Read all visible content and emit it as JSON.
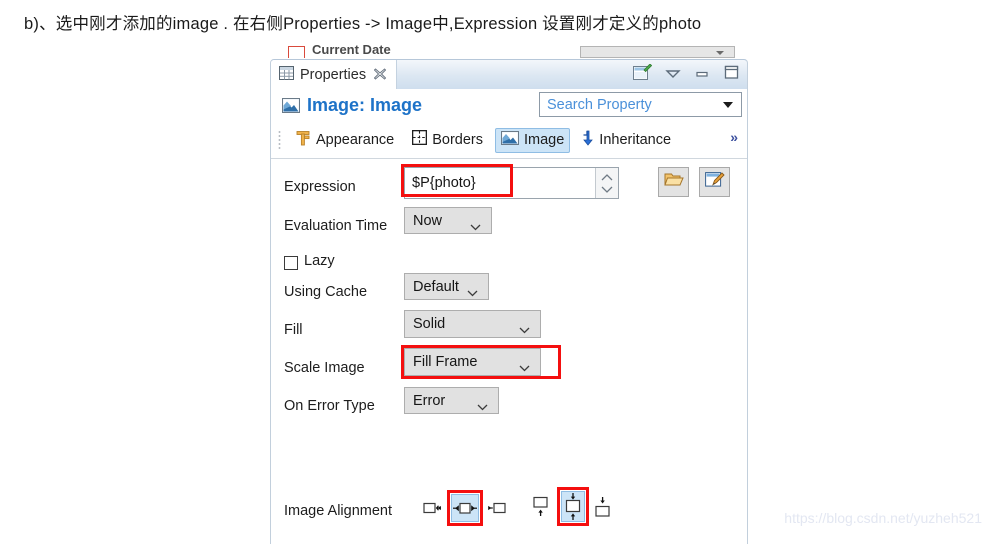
{
  "caption": "b)、选中刚才添加的image . 在右侧Properties -> Image中,Expression 设置刚才定义的photo",
  "cutoff_row": {
    "label": "Current Date"
  },
  "view": {
    "tab": {
      "title": "Properties",
      "close_glyph": "✄",
      "icon": "table-icon"
    },
    "toolbar": [
      {
        "name": "new-properties-view-icon",
        "label": ""
      },
      {
        "name": "view-menu-icon",
        "label": ""
      },
      {
        "name": "minimize-icon",
        "label": ""
      },
      {
        "name": "maximize-icon",
        "label": ""
      }
    ],
    "header": {
      "title": "Image: Image",
      "icon": "image-icon",
      "search_placeholder": "Search Property",
      "search_value": "Search Property"
    },
    "tabs": [
      {
        "label": "Appearance",
        "icon": "appearance-icon",
        "selected": false
      },
      {
        "label": "Borders",
        "icon": "borders-icon",
        "selected": false
      },
      {
        "label": "Image",
        "icon": "image-icon",
        "selected": true
      },
      {
        "label": "Inheritance",
        "icon": "inheritance-icon",
        "selected": false
      }
    ],
    "tabs_overflow": "»"
  },
  "fields": {
    "expression": {
      "label": "Expression",
      "value": "$P{photo}",
      "highlighted": true,
      "browse_button": "folder-open-icon",
      "edit_button": "edit-expression-icon"
    },
    "evaluation_time": {
      "label": "Evaluation Time",
      "value": "Now",
      "options": [
        "Now"
      ]
    },
    "lazy": {
      "label": "Lazy",
      "checked": false
    },
    "using_cache": {
      "label": "Using Cache",
      "value": "Default",
      "options": [
        "Default"
      ]
    },
    "fill": {
      "label": "Fill",
      "value": "Solid",
      "options": [
        "Solid"
      ]
    },
    "scale_image": {
      "label": "Scale Image",
      "value": "Fill Frame",
      "options": [
        "Fill Frame"
      ],
      "highlighted": true
    },
    "on_error_type": {
      "label": "On Error Type",
      "value": "Error",
      "options": [
        "Error"
      ]
    },
    "image_alignment": {
      "label": "Image Alignment",
      "horizontal": [
        {
          "name": "align-left-icon",
          "selected": false
        },
        {
          "name": "align-center-icon",
          "selected": true,
          "highlighted": true
        },
        {
          "name": "align-right-icon",
          "selected": false
        }
      ],
      "vertical": [
        {
          "name": "align-top-icon",
          "selected": false
        },
        {
          "name": "align-middle-icon",
          "selected": true,
          "highlighted": true
        },
        {
          "name": "align-bottom-icon",
          "selected": false
        }
      ]
    }
  },
  "watermark": "https://blog.csdn.net/yuzheh521"
}
